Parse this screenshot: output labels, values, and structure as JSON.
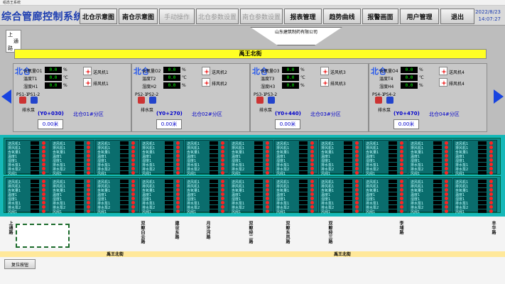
{
  "window_title": "组态王系统",
  "app_title": "综合管廊控制系统",
  "nav": [
    {
      "label": "北仓示意图",
      "disabled": false
    },
    {
      "label": "南仓示意图",
      "disabled": false
    },
    {
      "label": "手动操作",
      "disabled": true
    },
    {
      "label": "北仓参数设置",
      "disabled": true
    },
    {
      "label": "南仓参数设置",
      "disabled": true
    },
    {
      "label": "报表管理",
      "disabled": false
    },
    {
      "label": "趋势曲线",
      "disabled": false
    },
    {
      "label": "报警画面",
      "disabled": false
    },
    {
      "label": "用户管理",
      "disabled": false
    },
    {
      "label": "退出",
      "disabled": false
    }
  ],
  "datetime": {
    "date": "2022/8/23",
    "time": "14:07:27"
  },
  "upper": {
    "sign": {
      "top": "上",
      "mid": "通",
      "bottom": "路"
    },
    "factory": "山东建筑制药有限公司",
    "street": "禹王北街",
    "bays": [
      {
        "tag": "北仓",
        "sensors": [
          {
            "label": "含氧量O1",
            "value": "0.0",
            "unit": "%"
          },
          {
            "label": "温度T1",
            "value": "0.0",
            "unit": "℃"
          },
          {
            "label": "湿度H1",
            "value": "0.0",
            "unit": "%"
          }
        ],
        "fans": [
          "送风机1",
          "排风机1"
        ],
        "ps": [
          "PS1-1",
          "PS1-2"
        ],
        "pump": "排水泵",
        "level": "(Y0+030)",
        "zone": "北仓01#分区",
        "readout": "0.00米"
      },
      {
        "tag": "北仓",
        "sensors": [
          {
            "label": "含氧量O2",
            "value": "0.0",
            "unit": "%"
          },
          {
            "label": "温度T2",
            "value": "0.0",
            "unit": "℃"
          },
          {
            "label": "湿度H2",
            "value": "0.0",
            "unit": "%"
          }
        ],
        "fans": [
          "送风机2",
          "排风机2"
        ],
        "ps": [
          "PS2-1",
          "PS2-2"
        ],
        "pump": "排水泵",
        "level": "(Y0+270)",
        "zone": "北仓02#分区",
        "readout": "0.00米"
      },
      {
        "tag": "北仓",
        "sensors": [
          {
            "label": "含氧量O3",
            "value": "0.0",
            "unit": "%"
          },
          {
            "label": "温度T3",
            "value": "0.0",
            "unit": "℃"
          },
          {
            "label": "湿度H3",
            "value": "0.0",
            "unit": "%"
          }
        ],
        "fans": [
          "送风机3",
          "排风机3"
        ],
        "ps": [
          "PS3-1",
          "PS3-2"
        ],
        "pump": "排水泵",
        "level": "(Y0+440)",
        "zone": "北仓03#分区",
        "readout": "0.00米"
      },
      {
        "tag": "北仓",
        "sensors": [
          {
            "label": "含氧量O4",
            "value": "0.0",
            "unit": "%"
          },
          {
            "label": "温度T4",
            "value": "0.0",
            "unit": "℃"
          },
          {
            "label": "湿度H4",
            "value": "0.0",
            "unit": "%"
          }
        ],
        "fans": [
          "送风机4",
          "排风机4"
        ],
        "ps": [
          "PS4-1",
          "PS4-2"
        ],
        "pump": "排水泵",
        "level": "(Y0+470)",
        "zone": "北仓04#分区",
        "readout": "0.00米"
      }
    ]
  },
  "teal": {
    "cell_lines": [
      "送风机1",
      "排风机1",
      "含氧量1",
      "温度1",
      "湿度1",
      "排水泵1",
      "排水泵2",
      "风阀1"
    ]
  },
  "lower": {
    "roads": [
      "上通路",
      "双鲸白云路",
      "建设东路",
      "月牙河路",
      "双鲸经二路",
      "双鲸东岚路",
      "双鲸经三路",
      "李埔路",
      "丰华路"
    ],
    "street_left": "禹王北街",
    "street_right": "禹王北街",
    "reset_label": "复位按钮"
  }
}
